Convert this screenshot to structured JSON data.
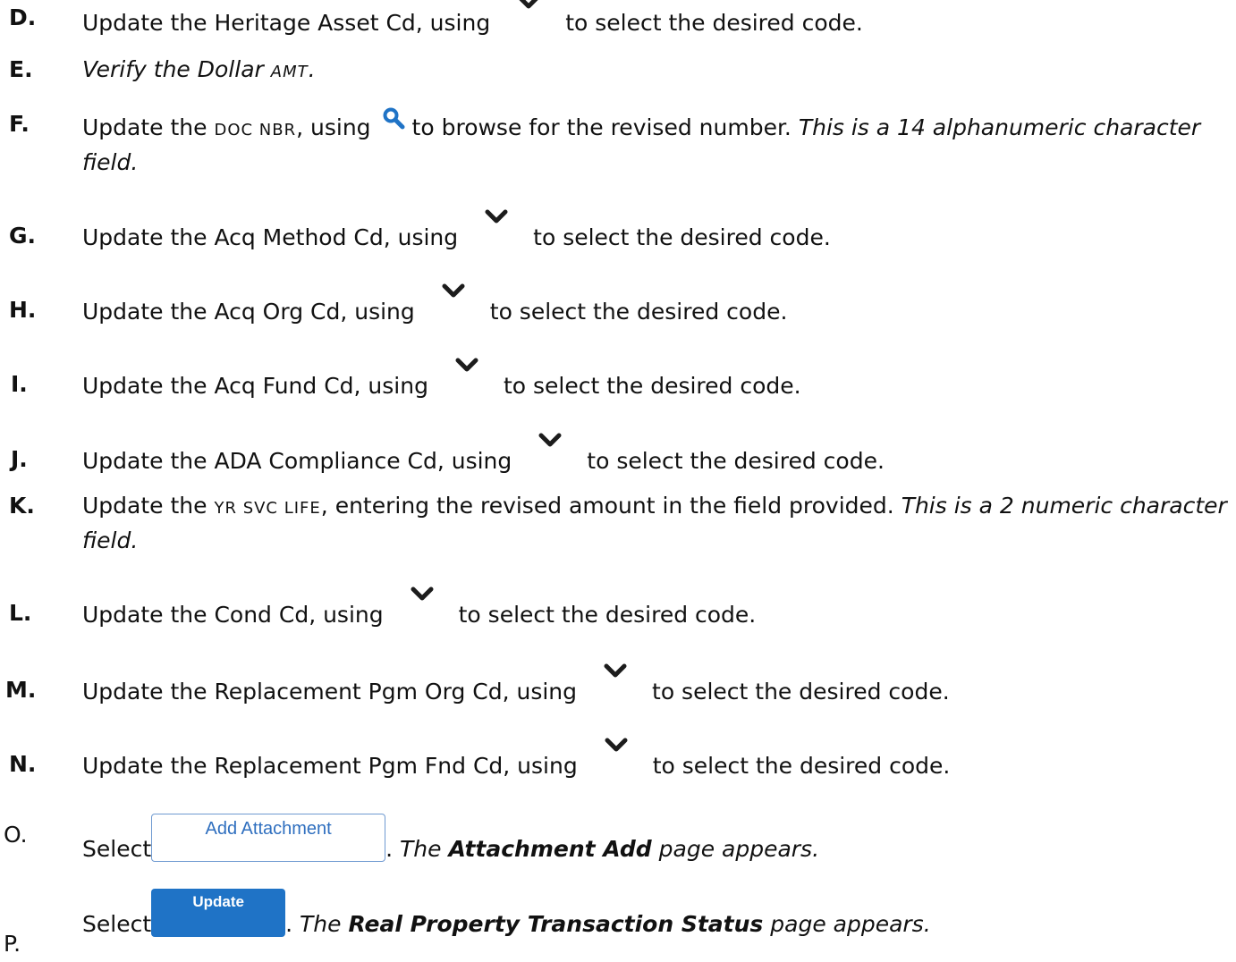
{
  "steps": [
    {
      "letter": "D.",
      "before": "Update the Heritage Asset Cd, using",
      "after": "to select the desired code.",
      "icon": "chevron-down-icon"
    },
    {
      "letter": "E.",
      "italic": "Verify the Dollar ",
      "italic_sc": "AMT",
      "italic_end": "."
    },
    {
      "letter": "F.",
      "before": "Update the ",
      "field_sc": "DOC NBR",
      "mid": ", using",
      "icon": "search-icon",
      "after": "to browse for the revised number. ",
      "note": "This is a 14 alphanumeric character field."
    },
    {
      "letter": "G.",
      "before": "Update the Acq Method Cd, using",
      "after": "to select the desired code.",
      "icon": "chevron-down-icon"
    },
    {
      "letter": "H.",
      "before": "Update the Acq Org Cd, using",
      "after": "to select the desired code.",
      "icon": "chevron-down-icon"
    },
    {
      "letter": "I.",
      "before": "Update the Acq Fund Cd, using",
      "after": "to select the desired code.",
      "icon": "chevron-down-icon"
    },
    {
      "letter": "J.",
      "before": "Update the ADA Compliance Cd, using",
      "after": "to select the desired code.",
      "icon": "chevron-down-icon"
    },
    {
      "letter": "K.",
      "before": "Update the ",
      "field_sc": "YR SVC LIFE",
      "after": ", entering the revised amount in the field provided. ",
      "note": "This is a 2 numeric character field."
    },
    {
      "letter": "L.",
      "before": "Update the Cond Cd, using",
      "after": "to select the desired code.",
      "icon": "chevron-down-icon"
    },
    {
      "letter": "M.",
      "before": "Update the Replacement Pgm Org Cd, using",
      "after": "to select the desired code.",
      "icon": "chevron-down-icon"
    },
    {
      "letter": "N.",
      "before": "Update the Replacement Pgm Fnd Cd, using",
      "after": "to select the desired code.",
      "icon": "chevron-down-icon"
    },
    {
      "letter": "O.",
      "before": "Select",
      "button": "Add Attachment",
      "after_pre": ". ",
      "after_em1": "The ",
      "after_bi": "Attachment Add",
      "after_em2": " page appears."
    },
    {
      "letter": "P.",
      "before": "Select",
      "button": "Update",
      "after_pre": ". ",
      "after_em1": "The ",
      "after_bi": "Real Property Transaction Status",
      "after_em2": " page appears."
    }
  ],
  "colors": {
    "icon": "#1c1c1c",
    "search_icon": "#1f73c6",
    "button_blue": "#1f73c6",
    "button_outline": "#6f9ad1"
  }
}
